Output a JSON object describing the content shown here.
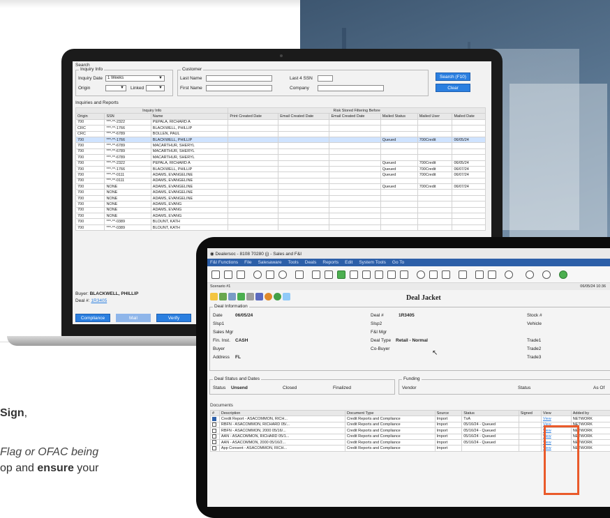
{
  "laptop": {
    "search_legend": "Search",
    "inquiry_info": "Inquiry Info",
    "inquiry_date_label": "Inquiry Date",
    "inquiry_date_value": "1 Weeks",
    "origin_label": "Origin",
    "linked_label": "Linked",
    "customer_legend": "Customer",
    "last_name_label": "Last Name",
    "first_name_label": "First Name",
    "last4_label": "Last 4 SSN",
    "company_label": "Company",
    "search_button": "Search (F10)",
    "clear_button": "Clear",
    "inquiries_legend": "Inquiries and Reports",
    "group_inquiry": "Inquiry Info",
    "group_risk": "Risk Stored Filtering Before",
    "columns": [
      "Origin",
      "SSN",
      "Name",
      "Print Created Date",
      "Email Created Date",
      "Email Created Date",
      "Mailed Status",
      "Mailed User",
      "Mailed Date"
    ],
    "rows": [
      [
        "700",
        "***-**-2322",
        "PEPALA, RICHARD A",
        "",
        "",
        "",
        "",
        "",
        ""
      ],
      [
        "CRC",
        "***-**-1766",
        "BLACKWELL, PHILLIP",
        "",
        "",
        "",
        "",
        "",
        ""
      ],
      [
        "CRC",
        "***-**-6789",
        "BOLLEN, PAUL",
        "",
        "",
        "",
        "",
        "",
        ""
      ],
      [
        "700",
        "***-**-1766",
        "BLACKWELL, PHILLIP",
        "",
        "",
        "",
        "Queued",
        "700Credit",
        "06/05/24"
      ],
      [
        "700",
        "***-**-6789",
        "MACARTHUR, SHERYL",
        "",
        "",
        "",
        "",
        "",
        ""
      ],
      [
        "700",
        "***-**-6789",
        "MACARTHUR, SHERYL",
        "",
        "",
        "",
        "",
        "",
        ""
      ],
      [
        "700",
        "***-**-6789",
        "MACARTHUR, SHERYL",
        "",
        "",
        "",
        "",
        "",
        ""
      ],
      [
        "700",
        "***-**-2322",
        "PEPALA, RICHARD A",
        "",
        "",
        "",
        "Queued",
        "700Credit",
        "06/05/24"
      ],
      [
        "700",
        "***-**-1766",
        "BLACKWELL, PHILLIP",
        "",
        "",
        "",
        "Queued",
        "700Credit",
        "06/07/24"
      ],
      [
        "700",
        "***-**-0111",
        "ADAMS, EVANGELINE",
        "",
        "",
        "",
        "Queued",
        "700Credit",
        "06/07/24"
      ],
      [
        "700",
        "***-**-0111",
        "ADAMS, EVANGELINE",
        "",
        "",
        "",
        "",
        "",
        ""
      ],
      [
        "700",
        "NONE",
        "ADAMS, EVANGELINE",
        "",
        "",
        "",
        "Queued",
        "700Credit",
        "06/07/24"
      ],
      [
        "700",
        "NONE",
        "ADAMS, EVANGELINE",
        "",
        "",
        "",
        "",
        "",
        ""
      ],
      [
        "700",
        "NONE",
        "ADAMS, EVANGELINE",
        "",
        "",
        "",
        "",
        "",
        ""
      ],
      [
        "700",
        "NONE",
        "ADAMS, EVANG",
        "",
        "",
        "",
        "",
        "",
        ""
      ],
      [
        "700",
        "NONE",
        "ADAMS, EVANG",
        "",
        "",
        "",
        "",
        "",
        ""
      ],
      [
        "700",
        "NONE",
        "ADAMS, EVANG",
        "",
        "",
        "",
        "",
        "",
        ""
      ],
      [
        "700",
        "***-**-0389",
        "BLOUNT, KATH",
        "",
        "",
        "",
        "",
        "",
        ""
      ],
      [
        "700",
        "***-**-0389",
        "BLOUNT, KATH",
        "",
        "",
        "",
        "",
        "",
        ""
      ]
    ],
    "buyer_label": "Buyer:",
    "buyer_value": "BLACKWELL, PHILLIP",
    "deal_label": "Deal #:",
    "deal_value": "1R3405",
    "btn_complete": "Compliance",
    "btn_mail": "Mail",
    "btn_verify": "Verify"
  },
  "tablet": {
    "title": "Dealersoc - 8108 70280 (j) - Sales and F&I",
    "menu": [
      "F&I Functions",
      "File",
      "Salesaware",
      "Tools",
      "Deals",
      "Reports",
      "Edit",
      "System Tools",
      "Go To"
    ],
    "subbar_left": "Scenario #1",
    "subbar_right": "06/05/24 10:36",
    "deal_jacket": "Deal Jacket",
    "deal_info_legend": "Deal Information",
    "date_label": "Date",
    "date_value": "06/05/24",
    "deal_no_label": "Deal #",
    "deal_no_value": "1R3405",
    "stock_label": "Stock #",
    "slsp1_label": "Slsp1",
    "slsp2_label": "Slsp2",
    "vehicle_label": "Vehicle",
    "sales_mgr_label": "Sales Mgr",
    "fi_mgr_label": "F&I Mgr",
    "fin_inst_label": "Fin. Inst.",
    "fin_inst_value": "CASH",
    "deal_type_label": "Deal Type",
    "deal_type_value": "Retail - Normal",
    "trade1_label": "Trade1",
    "buyer_label": "Buyer",
    "cobuyer_label": "Co-Buyer",
    "trade2_label": "Trade2",
    "address_label": "Address",
    "address_value": "FL",
    "trade3_label": "Trade3",
    "status_legend": "Deal Status and Dates",
    "status_label": "Status",
    "status_value": "Unsend",
    "closed_label": "Closed",
    "finalized_label": "Finalized",
    "funding_legend": "Funding",
    "vendor_label": "Vendor",
    "fstatus_label": "Status",
    "as_of_label": "As Of",
    "documents_legend": "Documents",
    "doc_columns": [
      "#",
      "Description",
      "Document Type",
      "Source",
      "Status",
      "Signed",
      "View",
      "Added by"
    ],
    "doc_rows": [
      [
        "",
        "Credit Report - ASACOMMON, RICH...",
        "Credit Reports and Compliance",
        "Import",
        "TxA",
        "",
        "View",
        "NETWORK"
      ],
      [
        "",
        "RBFN - ASACOMMON, RICHARD 05/...",
        "Credit Reports and Compliance",
        "Import",
        "05/16/24 - Queued",
        "",
        "View",
        "NETWORK"
      ],
      [
        "",
        "RBFN - ASACOMMON, 2000 05/16/...",
        "Credit Reports and Compliance",
        "Import",
        "05/16/24 - Queued",
        "",
        "View",
        "NETWORK"
      ],
      [
        "",
        "AAN - ASACOMMON, RICHARD 05/1...",
        "Credit Reports and Compliance",
        "Import",
        "05/16/24 - Queued",
        "",
        "View",
        "NETWORK"
      ],
      [
        "",
        "AAN - ASACOMMON, 2000 05/16/2...",
        "Credit Reports and Compliance",
        "Import",
        "05/16/24 - Queued",
        "",
        "View",
        "NETWORK"
      ],
      [
        "",
        "App Consent - ASACOMMON, RICH...",
        "Credit Reports and Compliance",
        "Import",
        "",
        "",
        "View",
        "NETWORK"
      ]
    ]
  },
  "copy": {
    "line1_bold": "Sign",
    "line1_tail": ",",
    "line2": "Flag or OFAC being",
    "line3_pre": "op and ",
    "line3_bold": "ensure",
    "line3_post": " your"
  }
}
